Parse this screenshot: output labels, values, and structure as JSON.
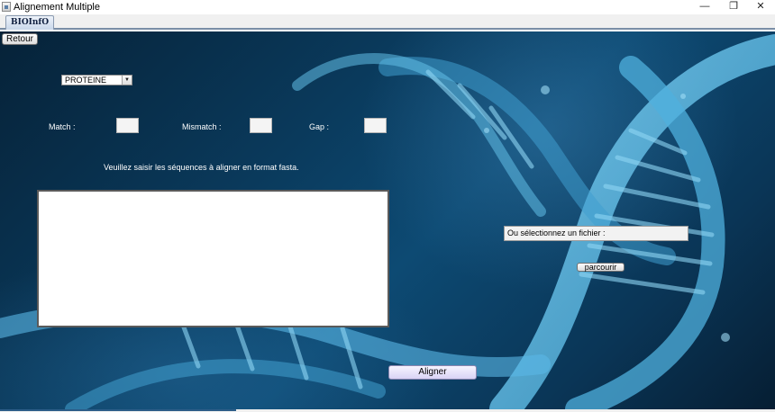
{
  "window": {
    "title": "Alignement Multiple",
    "controls": {
      "minimize": "—",
      "maximize": "❐",
      "close": "✕"
    }
  },
  "tabs": [
    {
      "label": "BIOInfO"
    }
  ],
  "form": {
    "back_label": "Retour",
    "sequence_type": "PROTEINE",
    "match_label": "Match :",
    "match_value": "",
    "mismatch_label": "Mismatch :",
    "mismatch_value": "",
    "gap_label": "Gap :",
    "gap_value": "",
    "instructions": "Veuillez saisir les séquences à aligner en format fasta.",
    "sequences_value": "",
    "file_label": "Ou sélectionnez un fichier :",
    "browse_label": "parcourir",
    "align_label": "Aligner"
  },
  "icons": {
    "app": "app-window-icon",
    "dropdown": "chevron-down-icon"
  },
  "colors": {
    "background_dark": "#062238",
    "background_mid": "#0d4a73",
    "helix": "#5ab8e6",
    "label_text": "#ffffff"
  }
}
